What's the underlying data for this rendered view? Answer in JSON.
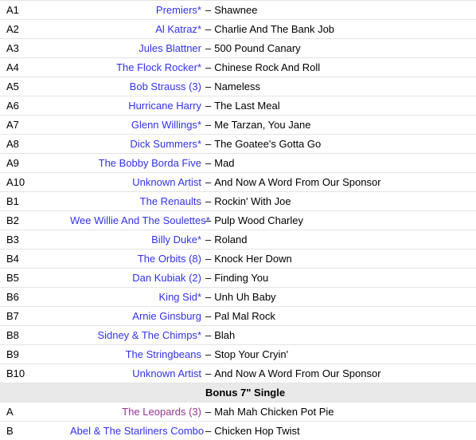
{
  "tracklist": {
    "separator": "–",
    "star": "*",
    "link_color": "#3232ee",
    "visited_link_color": "#993399",
    "heading_background": "#e9e9e9",
    "row_border_color": "#e4e4e4",
    "rows": [
      {
        "type": "track",
        "position": "A1",
        "artist": "Premiers",
        "star": true,
        "visited": false,
        "title": "Shawnee"
      },
      {
        "type": "track",
        "position": "A2",
        "artist": "Al Katraz",
        "star": true,
        "visited": false,
        "title": "Charlie And The Bank Job"
      },
      {
        "type": "track",
        "position": "A3",
        "artist": "Jules Blattner",
        "star": false,
        "visited": false,
        "title": "500 Pound Canary"
      },
      {
        "type": "track",
        "position": "A4",
        "artist": "The Flock Rocker",
        "star": true,
        "visited": false,
        "title": "Chinese Rock And Roll"
      },
      {
        "type": "track",
        "position": "A5",
        "artist": "Bob Strauss (3)",
        "star": false,
        "visited": false,
        "title": "Nameless"
      },
      {
        "type": "track",
        "position": "A6",
        "artist": "Hurricane Harry",
        "star": false,
        "visited": false,
        "title": "The Last Meal"
      },
      {
        "type": "track",
        "position": "A7",
        "artist": "Glenn Willings",
        "star": true,
        "visited": false,
        "title": "Me Tarzan, You Jane"
      },
      {
        "type": "track",
        "position": "A8",
        "artist": "Dick Summers",
        "star": true,
        "visited": false,
        "title": "The Goatee's Gotta Go"
      },
      {
        "type": "track",
        "position": "A9",
        "artist": "The Bobby Borda Five",
        "star": false,
        "visited": false,
        "title": "Mad"
      },
      {
        "type": "track",
        "position": "A10",
        "artist": "Unknown Artist",
        "star": false,
        "visited": false,
        "title": "And Now A Word From Our Sponsor"
      },
      {
        "type": "track",
        "position": "B1",
        "artist": "The Renaults",
        "star": false,
        "visited": false,
        "title": "Rockin' With Joe"
      },
      {
        "type": "track",
        "position": "B2",
        "artist": "Wee Willie And The Soulettes",
        "star": true,
        "visited": false,
        "title": "Pulp Wood Charley"
      },
      {
        "type": "track",
        "position": "B3",
        "artist": "Billy Duke",
        "star": true,
        "visited": false,
        "title": "Roland"
      },
      {
        "type": "track",
        "position": "B4",
        "artist": "The Orbits (8)",
        "star": false,
        "visited": false,
        "title": "Knock Her Down"
      },
      {
        "type": "track",
        "position": "B5",
        "artist": "Dan Kubiak (2)",
        "star": false,
        "visited": false,
        "title": "Finding You"
      },
      {
        "type": "track",
        "position": "B6",
        "artist": "King Sid",
        "star": true,
        "visited": false,
        "title": "Unh Uh Baby"
      },
      {
        "type": "track",
        "position": "B7",
        "artist": "Arnie Ginsburg",
        "star": false,
        "visited": false,
        "title": "Pal Mal Rock"
      },
      {
        "type": "track",
        "position": "B8",
        "artist": "Sidney & The Chimps",
        "star": true,
        "visited": false,
        "title": "Blah"
      },
      {
        "type": "track",
        "position": "B9",
        "artist": "The Stringbeans",
        "star": false,
        "visited": false,
        "title": "Stop Your Cryin'"
      },
      {
        "type": "track",
        "position": "B10",
        "artist": "Unknown Artist",
        "star": false,
        "visited": false,
        "title": "And Now A Word From Our Sponsor"
      },
      {
        "type": "heading",
        "position": "",
        "heading": "Bonus 7\" Single"
      },
      {
        "type": "track",
        "position": "A",
        "artist": "The Leopards (3)",
        "star": false,
        "visited": true,
        "title": "Mah Mah Chicken Pot Pie"
      },
      {
        "type": "track",
        "position": "B",
        "artist": "Abel & The Starliners Combo",
        "star": false,
        "visited": false,
        "title": "Chicken Hop Twist"
      }
    ]
  }
}
